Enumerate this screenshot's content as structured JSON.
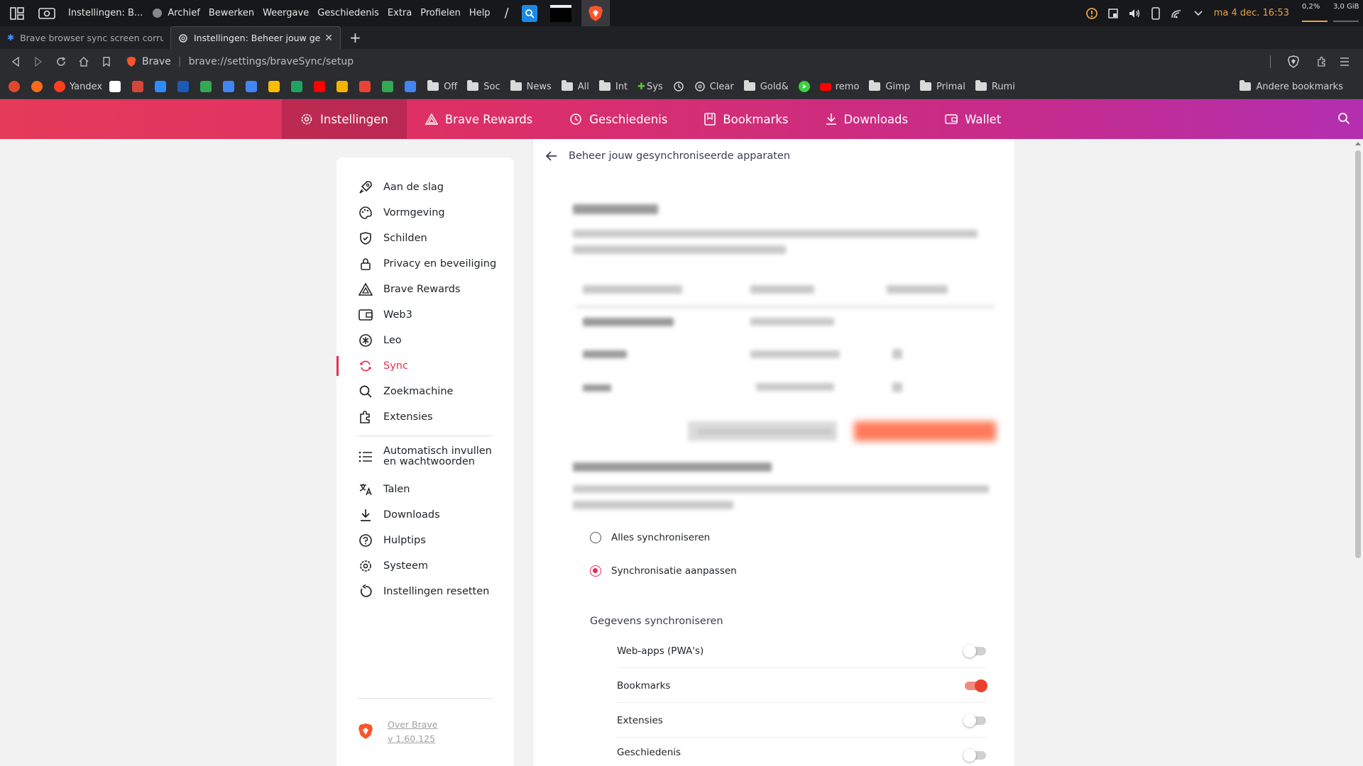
{
  "os_bar": {
    "window_title": "Instellingen: B...",
    "menus": [
      "Archief",
      "Bewerken",
      "Weergave",
      "Geschiedenis",
      "Extra",
      "Profielen",
      "Help"
    ],
    "clock": "ma 4 dec. 16:53",
    "cpu": "0,2%",
    "mem": "3,0 GiB",
    "accent_color": "#e7a04a"
  },
  "tabs": [
    {
      "title": "Brave browser sync screen corrupted",
      "active": false
    },
    {
      "title": "Instellingen: Beheer jouw gesynchroniseerde apparaten",
      "active": true
    }
  ],
  "toolbar": {
    "brand": "Brave",
    "url": "brave://settings/braveSync/setup"
  },
  "bookmarks": [
    {
      "label": "",
      "color": "#e0482c"
    },
    {
      "label": "",
      "color": "#ff6b1a"
    },
    {
      "label": "Yandex",
      "color": "#fc3f1d"
    },
    {
      "label": "",
      "color": "#ffffff"
    },
    {
      "label": "",
      "color": "#d44638"
    },
    {
      "label": "",
      "color": "#2d8cff"
    },
    {
      "label": "",
      "color": "#1b5ab6"
    },
    {
      "label": "",
      "color": "#34a853"
    },
    {
      "label": "",
      "color": "#4285f4"
    },
    {
      "label": "",
      "color": "#4285f4"
    },
    {
      "label": "",
      "color": "#fbbc04"
    },
    {
      "label": "",
      "color": "#1fa463"
    },
    {
      "label": "",
      "color": "#ff0000"
    },
    {
      "label": "",
      "color": "#f4b400"
    },
    {
      "label": "",
      "color": "#ea4335"
    },
    {
      "label": "",
      "color": "#34a853"
    },
    {
      "label": "",
      "color": "#4285f4"
    }
  ],
  "bookmark_folders": [
    "Off",
    "Soc",
    "News",
    "All",
    "Int"
  ],
  "bookmark_more": [
    {
      "label": "Sys",
      "kind": "puzzle"
    },
    {
      "label": "",
      "kind": "history"
    },
    {
      "label": "Clear",
      "kind": "gear"
    },
    {
      "label": "Gold&",
      "kind": "folder"
    },
    {
      "label": "",
      "kind": "play"
    },
    {
      "label": "remo",
      "kind": "youtube"
    },
    {
      "label": "Gimp",
      "kind": "folder"
    },
    {
      "label": "Primal",
      "kind": "folder"
    },
    {
      "label": "Rumi",
      "kind": "folder"
    }
  ],
  "other_bookmarks": "Andere bookmarks",
  "topnav": [
    {
      "label": "Instellingen",
      "icon": "gear-icon",
      "active": true
    },
    {
      "label": "Brave Rewards",
      "icon": "rewards-triangle-icon",
      "active": false
    },
    {
      "label": "Geschiedenis",
      "icon": "history-icon",
      "active": false
    },
    {
      "label": "Bookmarks",
      "icon": "bookmark-icon",
      "active": false
    },
    {
      "label": "Downloads",
      "icon": "download-icon",
      "active": false
    },
    {
      "label": "Wallet",
      "icon": "wallet-icon",
      "active": false
    }
  ],
  "sidebar": {
    "items": [
      {
        "label": "Aan de slag",
        "icon": "rocket-icon"
      },
      {
        "label": "Vormgeving",
        "icon": "palette-icon"
      },
      {
        "label": "Schilden",
        "icon": "shield-icon"
      },
      {
        "label": "Privacy en beveiliging",
        "icon": "lock-icon"
      },
      {
        "label": "Brave Rewards",
        "icon": "rewards-triangle-icon"
      },
      {
        "label": "Web3",
        "icon": "wallet-icon"
      },
      {
        "label": "Leo",
        "icon": "leo-icon"
      },
      {
        "label": "Sync",
        "icon": "sync-icon",
        "active": true
      },
      {
        "label": "Zoekmachine",
        "icon": "search-icon"
      },
      {
        "label": "Extensies",
        "icon": "puzzle-icon"
      }
    ],
    "items2": [
      {
        "label": "Automatisch invullen en wachtwoorden",
        "icon": "list-icon"
      },
      {
        "label": "Talen",
        "icon": "translate-icon"
      },
      {
        "label": "Downloads",
        "icon": "download-icon"
      },
      {
        "label": "Hulptips",
        "icon": "help-icon"
      },
      {
        "label": "Systeem",
        "icon": "gear-icon"
      },
      {
        "label": "Instellingen resetten",
        "icon": "reset-icon"
      }
    ],
    "about_label": "Over Brave",
    "version": "v 1.60.125",
    "accent_color": "#e92c52"
  },
  "main": {
    "header": "Beheer jouw gesynchroniseerde apparaten",
    "radios": [
      {
        "label": "Alles synchroniseren",
        "selected": false
      },
      {
        "label": "Synchronisatie aanpassen",
        "selected": true
      }
    ],
    "section_title": "Gegevens synchroniseren",
    "sync_items": [
      {
        "label": "Web-apps (PWA's)",
        "enabled": false
      },
      {
        "label": "Bookmarks",
        "enabled": true
      },
      {
        "label": "Extensies",
        "enabled": false
      },
      {
        "label": "Geschiedenis",
        "enabled": false
      }
    ]
  }
}
